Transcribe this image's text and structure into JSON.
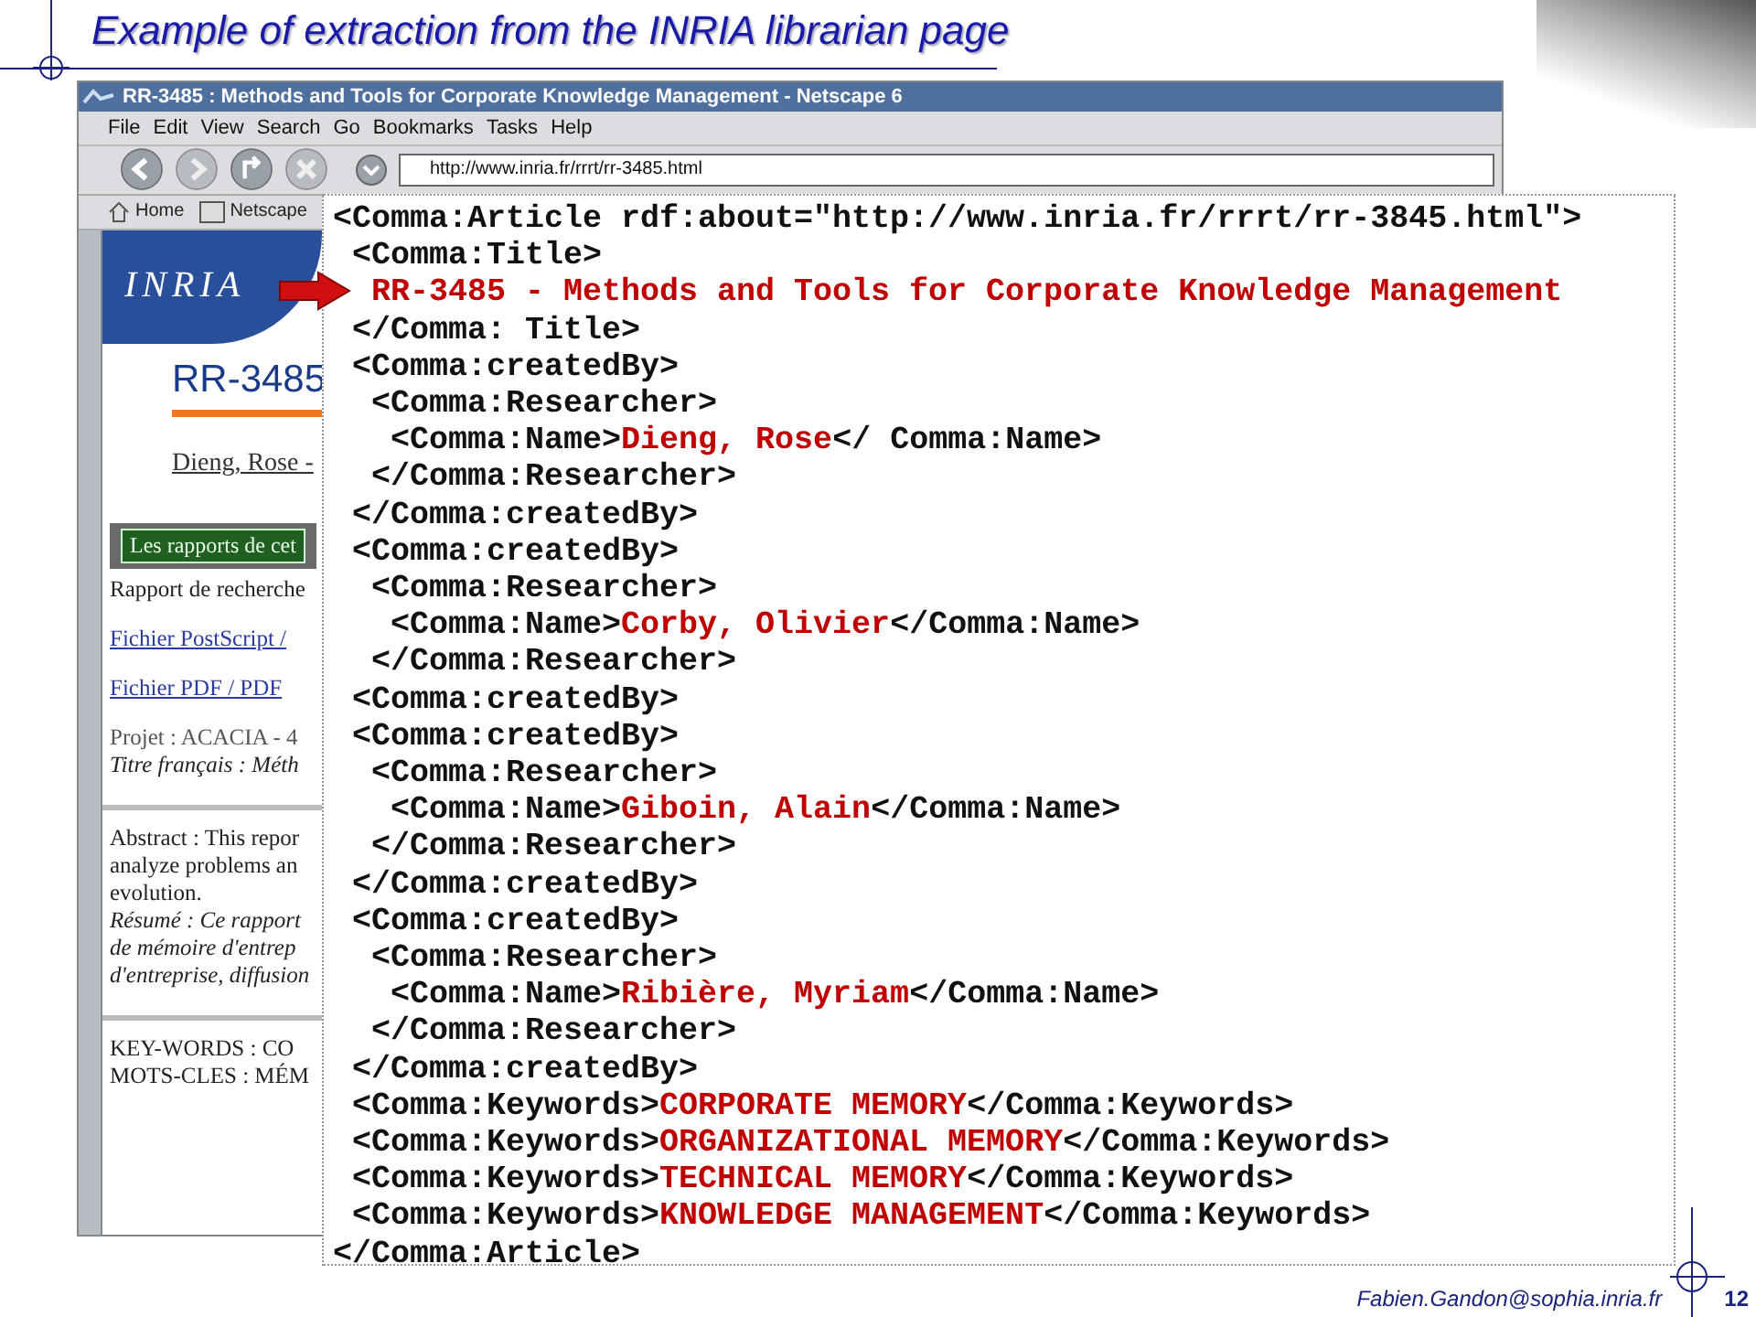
{
  "slide": {
    "title": "Example of extraction from the INRIA librarian page",
    "footer": "Fabien.Gandon@sophia.inria.fr",
    "page_number": "12"
  },
  "browser": {
    "title": "RR-3485 : Methods and Tools for Corporate Knowledge Management - Netscape 6",
    "menu": [
      "File",
      "Edit",
      "View",
      "Search",
      "Go",
      "Bookmarks",
      "Tasks",
      "Help"
    ],
    "url": "http://www.inria.fr/rrrt/rr-3485.html",
    "personal_bar": [
      "Home",
      "Netscape"
    ],
    "page": {
      "logo": "INRIA",
      "heading": "RR-3485",
      "authors": "Dieng, Rose -",
      "reports_button": "Les rapports de cet",
      "lines": [
        {
          "kind": "plain",
          "text": "Rapport de recherche"
        },
        {
          "kind": "link",
          "text": "Fichier PostScript /"
        },
        {
          "kind": "link",
          "text": "Fichier PDF / PDF"
        },
        {
          "kind": "project",
          "text": "Projet : ACACIA - 4"
        },
        {
          "kind": "italic",
          "text": "Titre français : Méth"
        },
        {
          "kind": "rule"
        },
        {
          "kind": "plain",
          "text": "Abstract : This repor"
        },
        {
          "kind": "plain",
          "text": "analyze problems an"
        },
        {
          "kind": "plain",
          "text": "evolution."
        },
        {
          "kind": "italic",
          "text": "Résumé : Ce rapport"
        },
        {
          "kind": "italic",
          "text": "de mémoire d'entrep"
        },
        {
          "kind": "italic",
          "text": "d'entreprise, diffusion"
        },
        {
          "kind": "rule"
        },
        {
          "kind": "plain",
          "text": "KEY-WORDS : CO"
        },
        {
          "kind": "plain",
          "text": "MOTS-CLES : MÉM"
        }
      ]
    }
  },
  "extraction": [
    {
      "open": "<Comma:Article rdf:about=\"http://www.inria.fr/rrrt/rr-3845.html\">",
      "children": [
        {
          "open": "<Comma:Title>",
          "children": [
            {
              "value": "RR-3485 - Methods and Tools for Corporate Knowledge Management"
            }
          ]
        },
        {
          "close": "</Comma: Title>"
        },
        {
          "open": "<Comma:createdBy>",
          "children": [
            {
              "open": "<Comma:Researcher>",
              "children": [
                {
                  "open": "<Comma:Name>",
                  "value": "Dieng, Rose",
                  "close": "</ Comma:Name>"
                }
              ]
            },
            {
              "close": "</Comma:Researcher>"
            }
          ]
        },
        {
          "close": "</Comma:createdBy>"
        },
        {
          "open": "<Comma:createdBy>",
          "children": [
            {
              "open": "<Comma:Researcher>",
              "children": [
                {
                  "open": "<Comma:Name>",
                  "value": "Corby, Olivier",
                  "close": "</Comma:Name>"
                }
              ]
            },
            {
              "close": "</Comma:Researcher>"
            }
          ]
        },
        {
          "open": "<Comma:createdBy>"
        },
        {
          "open": "<Comma:createdBy>",
          "children": [
            {
              "open": "<Comma:Researcher>",
              "children": [
                {
                  "open": "<Comma:Name>",
                  "value": "Giboin, Alain",
                  "close": "</Comma:Name>"
                }
              ]
            },
            {
              "close": "</Comma:Researcher>"
            }
          ]
        },
        {
          "close": "</Comma:createdBy>"
        },
        {
          "open": "<Comma:createdBy>",
          "children": [
            {
              "open": "<Comma:Researcher>",
              "children": [
                {
                  "open": "<Comma:Name>",
                  "value": "Ribière, Myriam",
                  "close": "</Comma:Name>"
                }
              ]
            },
            {
              "close": "</Comma:Researcher>"
            }
          ]
        },
        {
          "close": "</Comma:createdBy>"
        },
        {
          "open": "<Comma:Keywords>",
          "value": "CORPORATE MEMORY",
          "close": "</Comma:Keywords>"
        },
        {
          "open": "<Comma:Keywords>",
          "value": "ORGANIZATIONAL MEMORY",
          "close": "</Comma:Keywords>"
        },
        {
          "open": "<Comma:Keywords>",
          "value": "TECHNICAL MEMORY",
          "close": "</Comma:Keywords>"
        },
        {
          "open": "<Comma:Keywords>",
          "value": "KNOWLEDGE MANAGEMENT",
          "close": "</Comma:Keywords>"
        }
      ]
    },
    {
      "close": "</Comma:Article>"
    }
  ]
}
